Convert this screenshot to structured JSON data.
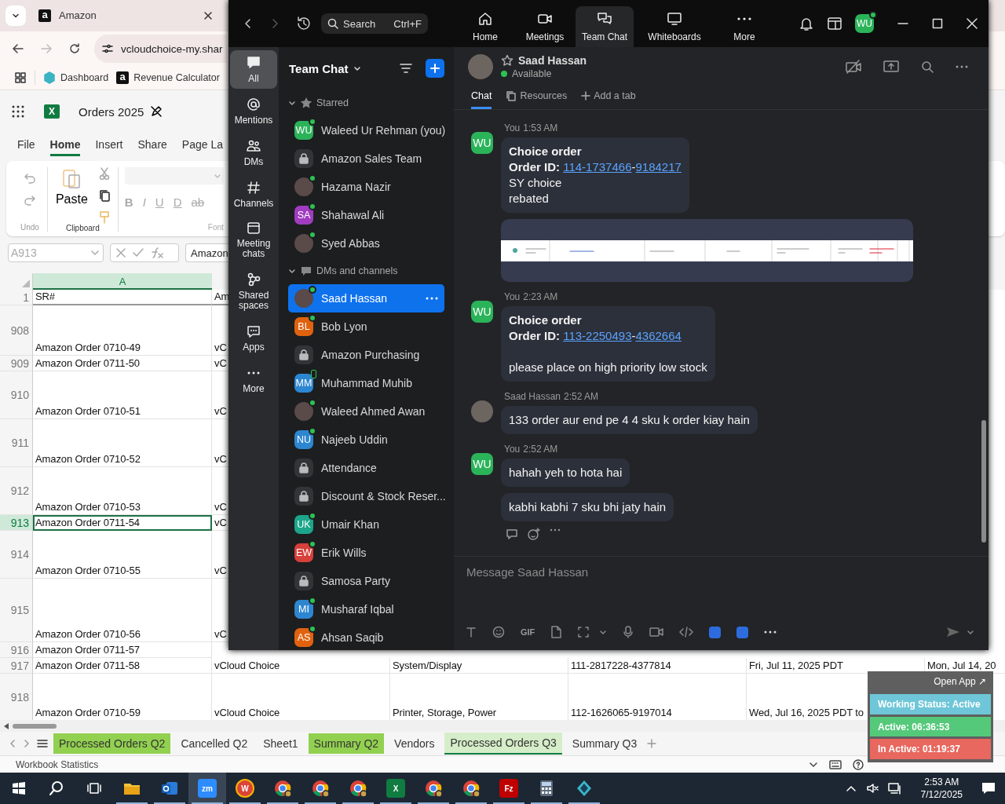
{
  "browser": {
    "tab": {
      "favicon": "a",
      "title": "Amazon"
    },
    "address": "vcloudchoice-my.shar",
    "bookmarks": [
      {
        "label": "Dashboard"
      },
      {
        "logo": "a",
        "label": "Revenue Calculator"
      }
    ]
  },
  "excel": {
    "logo": "X",
    "title": "Orders 2025",
    "ribbon_tabs": [
      {
        "label": "File",
        "selected": false
      },
      {
        "label": "Home",
        "selected": true
      },
      {
        "label": "Insert",
        "selected": false
      },
      {
        "label": "Share",
        "selected": false
      },
      {
        "label": "Page La",
        "selected": false
      }
    ],
    "ribbon": {
      "undo_label": "Undo",
      "paste_label": "Paste",
      "clipboard_label": "Clipboard",
      "font_buttons": [
        "B",
        "I",
        "U",
        "D",
        "ab"
      ],
      "font_label": "Font"
    },
    "name_box": "A913",
    "formula": "Amazon",
    "columns": [
      {
        "label": "A",
        "selected": true
      }
    ],
    "header_row": {
      "number": "1",
      "cells": [
        "SR#",
        "Am"
      ]
    },
    "rows": [
      {
        "number": "908",
        "selected": false,
        "cells": [
          "Amazon Order 0710-49",
          "vC"
        ]
      },
      {
        "number": "909",
        "selected": false,
        "cells": [
          "Amazon Order 0711-50",
          "vC"
        ]
      },
      {
        "number": "910",
        "selected": false,
        "cells": [
          "Amazon Order 0710-51",
          "vC"
        ]
      },
      {
        "number": "911",
        "selected": false,
        "cells": [
          "Amazon Order 0710-52",
          "vC"
        ]
      },
      {
        "number": "912",
        "selected": false,
        "cells": [
          "Amazon Order 0710-53",
          "vC"
        ]
      },
      {
        "number": "913",
        "selected": true,
        "cells": [
          "Amazon Order 0711-54",
          "vC"
        ]
      },
      {
        "number": "914",
        "selected": false,
        "cells": [
          "Amazon Order 0710-55",
          "vC"
        ]
      },
      {
        "number": "915",
        "selected": false,
        "cells": [
          "Amazon Order 0710-56",
          "vC"
        ]
      },
      {
        "number": "916",
        "selected": false,
        "cells": [
          "Amazon Order 0711-57"
        ]
      },
      {
        "number": "917",
        "selected": false,
        "cells": [
          "Amazon Order 0711-58",
          "vCloud Choice",
          "System/Display",
          "111-2817228-4377814",
          "Fri, Jul 11, 2025 PDT",
          "Mon, Jul 14, 20"
        ]
      },
      {
        "number": "918",
        "selected": false,
        "cells": [
          "Amazon Order 0710-59",
          "vCloud Choice",
          "Printer, Storage, Power",
          "112-1626065-9197014",
          "Wed, Jul 16, 2025 PDT to"
        ]
      }
    ],
    "sheet_tabs": [
      {
        "label": "Processed Orders Q2",
        "selected": false,
        "color": "#92d050"
      },
      {
        "label": "Cancelled Q2",
        "selected": false
      },
      {
        "label": "Sheet1",
        "selected": false
      },
      {
        "label": "Summary Q2",
        "selected": false,
        "color": "#92d050"
      },
      {
        "label": "Vendors",
        "selected": false
      },
      {
        "label": "Processed Orders Q3",
        "selected": true
      },
      {
        "label": "Summary Q3",
        "selected": false
      }
    ],
    "status": "Workbook Statistics"
  },
  "zoom": {
    "search": {
      "placeholder": "Search",
      "shortcut": "Ctrl+F"
    },
    "nav": [
      {
        "label": "Home",
        "selected": false
      },
      {
        "label": "Meetings",
        "selected": false
      },
      {
        "label": "Team Chat",
        "selected": true
      },
      {
        "label": "Whiteboards",
        "selected": false
      },
      {
        "label": "More",
        "selected": false
      }
    ],
    "account": {
      "initials": "WU",
      "color": "#2bb35a"
    },
    "rail": [
      {
        "label": "All",
        "selected": true
      },
      {
        "label": "Mentions",
        "selected": false
      },
      {
        "label": "DMs",
        "selected": false
      },
      {
        "label": "Channels",
        "selected": false
      },
      {
        "label": "Meeting chats",
        "selected": false
      },
      {
        "label": "Shared spaces",
        "selected": false
      },
      {
        "label": "Apps",
        "selected": false
      },
      {
        "label": "More",
        "selected": false
      }
    ],
    "list_title": "Team Chat",
    "sections": [
      {
        "title": "Starred",
        "expanded": true,
        "items": [
          {
            "name": "Waleed Ur Rehman (you)",
            "avatar": {
              "kind": "initials",
              "initials": "WU",
              "color": "#2bb35a"
            },
            "online": true,
            "mobile": false,
            "selected": false
          },
          {
            "name": "Amazon Sales Team",
            "avatar": {
              "kind": "channel"
            },
            "online": false,
            "mobile": false,
            "selected": false
          },
          {
            "name": "Hazama Nazir",
            "avatar": {
              "kind": "photo"
            },
            "online": true,
            "mobile": false,
            "selected": false
          },
          {
            "name": "Shahawal Ali",
            "avatar": {
              "kind": "initials",
              "initials": "SA",
              "color": "#a03cc0"
            },
            "online": true,
            "mobile": false,
            "selected": false
          },
          {
            "name": "Syed Abbas",
            "avatar": {
              "kind": "photo"
            },
            "online": true,
            "mobile": false,
            "selected": false
          }
        ]
      },
      {
        "title": "DMs and channels",
        "expanded": true,
        "items": [
          {
            "name": "Saad Hassan",
            "avatar": {
              "kind": "photo"
            },
            "online": true,
            "mobile": false,
            "selected": true
          },
          {
            "name": "Bob Lyon",
            "avatar": {
              "kind": "initials",
              "initials": "BL",
              "color": "#e0620f"
            },
            "online": true,
            "mobile": false,
            "selected": false
          },
          {
            "name": "Amazon Purchasing",
            "avatar": {
              "kind": "channel"
            },
            "online": false,
            "mobile": false,
            "selected": false
          },
          {
            "name": "Muhammad Muhib",
            "avatar": {
              "kind": "initials",
              "initials": "MM",
              "color": "#2d86d0"
            },
            "online": false,
            "mobile": true,
            "selected": false
          },
          {
            "name": "Waleed Ahmed Awan",
            "avatar": {
              "kind": "photo"
            },
            "online": true,
            "mobile": false,
            "selected": false
          },
          {
            "name": "Najeeb Uddin",
            "avatar": {
              "kind": "initials",
              "initials": "NU",
              "color": "#2d86d0"
            },
            "online": true,
            "mobile": false,
            "selected": false
          },
          {
            "name": "Attendance",
            "avatar": {
              "kind": "channel"
            },
            "online": false,
            "mobile": false,
            "selected": false
          },
          {
            "name": "Discount & Stock Reser...",
            "avatar": {
              "kind": "channel"
            },
            "online": false,
            "mobile": false,
            "selected": false
          },
          {
            "name": "Umair Khan",
            "avatar": {
              "kind": "initials",
              "initials": "UK",
              "color": "#1ca58a"
            },
            "online": true,
            "mobile": false,
            "selected": false
          },
          {
            "name": "Erik Wills",
            "avatar": {
              "kind": "initials",
              "initials": "EW",
              "color": "#d6403a"
            },
            "online": true,
            "mobile": false,
            "selected": false
          },
          {
            "name": "Samosa Party",
            "avatar": {
              "kind": "channel"
            },
            "online": false,
            "mobile": false,
            "selected": false
          },
          {
            "name": "Musharaf Iqbal",
            "avatar": {
              "kind": "initials",
              "initials": "MI",
              "color": "#2d86d0"
            },
            "online": true,
            "mobile": false,
            "selected": false
          },
          {
            "name": "Ahsan Saqib",
            "avatar": {
              "kind": "initials",
              "initials": "AS",
              "color": "#e0620f"
            },
            "online": true,
            "mobile": false,
            "selected": false
          }
        ]
      }
    ],
    "conversation": {
      "name": "Saad Hassan",
      "starred": false,
      "presence": "Available",
      "tabs": [
        {
          "label": "Chat",
          "selected": true
        },
        {
          "label": "Resources",
          "selected": false
        },
        {
          "label": "Add a tab",
          "selected": false
        }
      ],
      "messages": [
        {
          "sender": "You",
          "time": "1:53 AM",
          "avatar": {
            "kind": "initials",
            "initials": "WU",
            "color": "#2bb35a"
          },
          "items": [
            {
              "kind": "text",
              "lines": [
                {
                  "kind": "text",
                  "parts": [
                    {
                      "kind": "bold",
                      "text": "Choice order"
                    }
                  ]
                },
                {
                  "kind": "text",
                  "parts": [
                    {
                      "kind": "bold",
                      "text": "Order ID: "
                    },
                    {
                      "kind": "link",
                      "text": "114-1737466"
                    },
                    {
                      "kind": "plain",
                      "text": "-"
                    },
                    {
                      "kind": "link",
                      "text": "9184217"
                    }
                  ]
                },
                {
                  "kind": "text",
                  "parts": [
                    {
                      "kind": "plain",
                      "text": "SY choice"
                    }
                  ]
                },
                {
                  "kind": "text",
                  "parts": [
                    {
                      "kind": "plain",
                      "text": "rebated"
                    }
                  ]
                }
              ]
            },
            {
              "kind": "image"
            }
          ]
        },
        {
          "sender": "You",
          "time": "2:23 AM",
          "avatar": {
            "kind": "initials",
            "initials": "WU",
            "color": "#2bb35a"
          },
          "items": [
            {
              "kind": "text",
              "lines": [
                {
                  "kind": "text",
                  "parts": [
                    {
                      "kind": "bold",
                      "text": "Choice order"
                    }
                  ]
                },
                {
                  "kind": "text",
                  "parts": [
                    {
                      "kind": "bold",
                      "text": "Order ID: "
                    },
                    {
                      "kind": "link",
                      "text": "113-2250493"
                    },
                    {
                      "kind": "plain",
                      "text": "-"
                    },
                    {
                      "kind": "link",
                      "text": "4362664"
                    }
                  ]
                },
                {
                  "kind": "spacer"
                },
                {
                  "kind": "text",
                  "parts": [
                    {
                      "kind": "plain",
                      "text": "please place on high priority low stock"
                    }
                  ]
                }
              ]
            }
          ]
        },
        {
          "sender": "Saad Hassan",
          "time": "2:52 AM",
          "avatar": {
            "kind": "photo"
          },
          "items": [
            {
              "kind": "text",
              "lines": [
                {
                  "kind": "text",
                  "parts": [
                    {
                      "kind": "plain",
                      "text": "133 order aur end pe 4 4 sku k order kiay hain"
                    }
                  ]
                }
              ]
            }
          ]
        },
        {
          "sender": "You",
          "time": "2:52 AM",
          "avatar": {
            "kind": "initials",
            "initials": "WU",
            "color": "#2bb35a"
          },
          "actions": true,
          "items": [
            {
              "kind": "text",
              "lines": [
                {
                  "kind": "text",
                  "parts": [
                    {
                      "kind": "plain",
                      "text": "hahah yeh to hota hai"
                    }
                  ]
                }
              ]
            },
            {
              "kind": "text",
              "lines": [
                {
                  "kind": "text",
                  "parts": [
                    {
                      "kind": "plain",
                      "text": "kabhi kabhi 7 sku bhi jaty hain"
                    }
                  ]
                }
              ]
            }
          ]
        }
      ],
      "composer": {
        "placeholder": "Message Saad Hassan",
        "gif": "GIF"
      }
    }
  },
  "tracker": {
    "open_app": "Open App ↗",
    "rows": [
      {
        "label": "Working Status: Active",
        "color": "#6ec6d8"
      },
      {
        "label": "Active: 06:36:53",
        "color": "#55c97a"
      },
      {
        "label": "In Active: 01:19:37",
        "color": "#e8675e"
      }
    ]
  },
  "taskbar": {
    "apps": [
      {
        "running": true,
        "active": false
      },
      {
        "running": true,
        "active": false
      },
      {
        "badge": "zm",
        "running": true,
        "active": true
      },
      {
        "badge": "W",
        "running": true,
        "active": false
      },
      {
        "running": true,
        "active": false
      },
      {
        "running": true,
        "active": false
      },
      {
        "running": true,
        "active": false
      },
      {
        "badge": "X",
        "running": true,
        "active": false
      },
      {
        "running": true,
        "active": false
      },
      {
        "running": true,
        "active": false
      },
      {
        "badge": "Fz",
        "running": true,
        "active": false
      },
      {
        "running": true,
        "active": false
      },
      {
        "running": true,
        "active": false
      }
    ],
    "time": "2:53 AM",
    "date": "7/12/2025"
  }
}
